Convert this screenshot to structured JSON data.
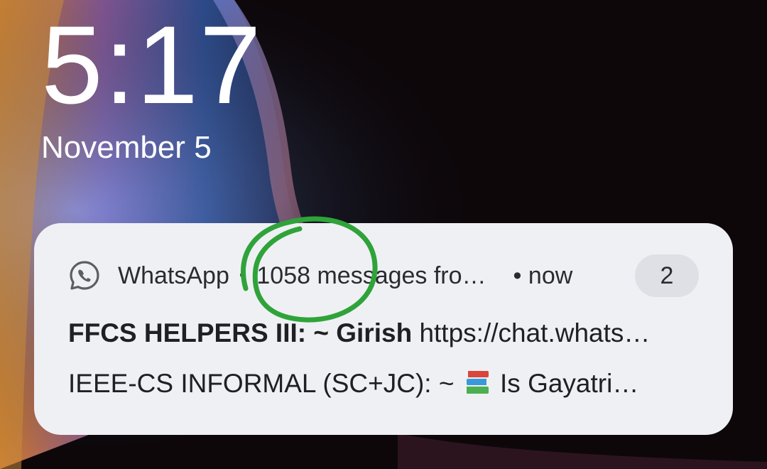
{
  "lockscreen": {
    "time": "5:17",
    "date": "November 5"
  },
  "notification": {
    "app_icon": "whatsapp-icon",
    "app_name": "WhatsApp",
    "separator": "•",
    "summary": "1058 messages fro…",
    "time_separator": "•",
    "time": "now",
    "count": "2",
    "messages": [
      {
        "group": "FFCS HELPERS III:",
        "sender": "~ Girish",
        "text": "https://chat.whats…"
      },
      {
        "group": "IEEE-CS INFORMAL (SC+JC):",
        "sender": "~",
        "emoji": "books-icon",
        "text": "Is Gayatri…"
      }
    ]
  },
  "annotation": {
    "type": "hand-drawn-circle",
    "color": "#2fa33a"
  },
  "colors": {
    "card_bg": "#eff0f4",
    "badge_bg": "#dfe0e5",
    "text": "#202024"
  }
}
